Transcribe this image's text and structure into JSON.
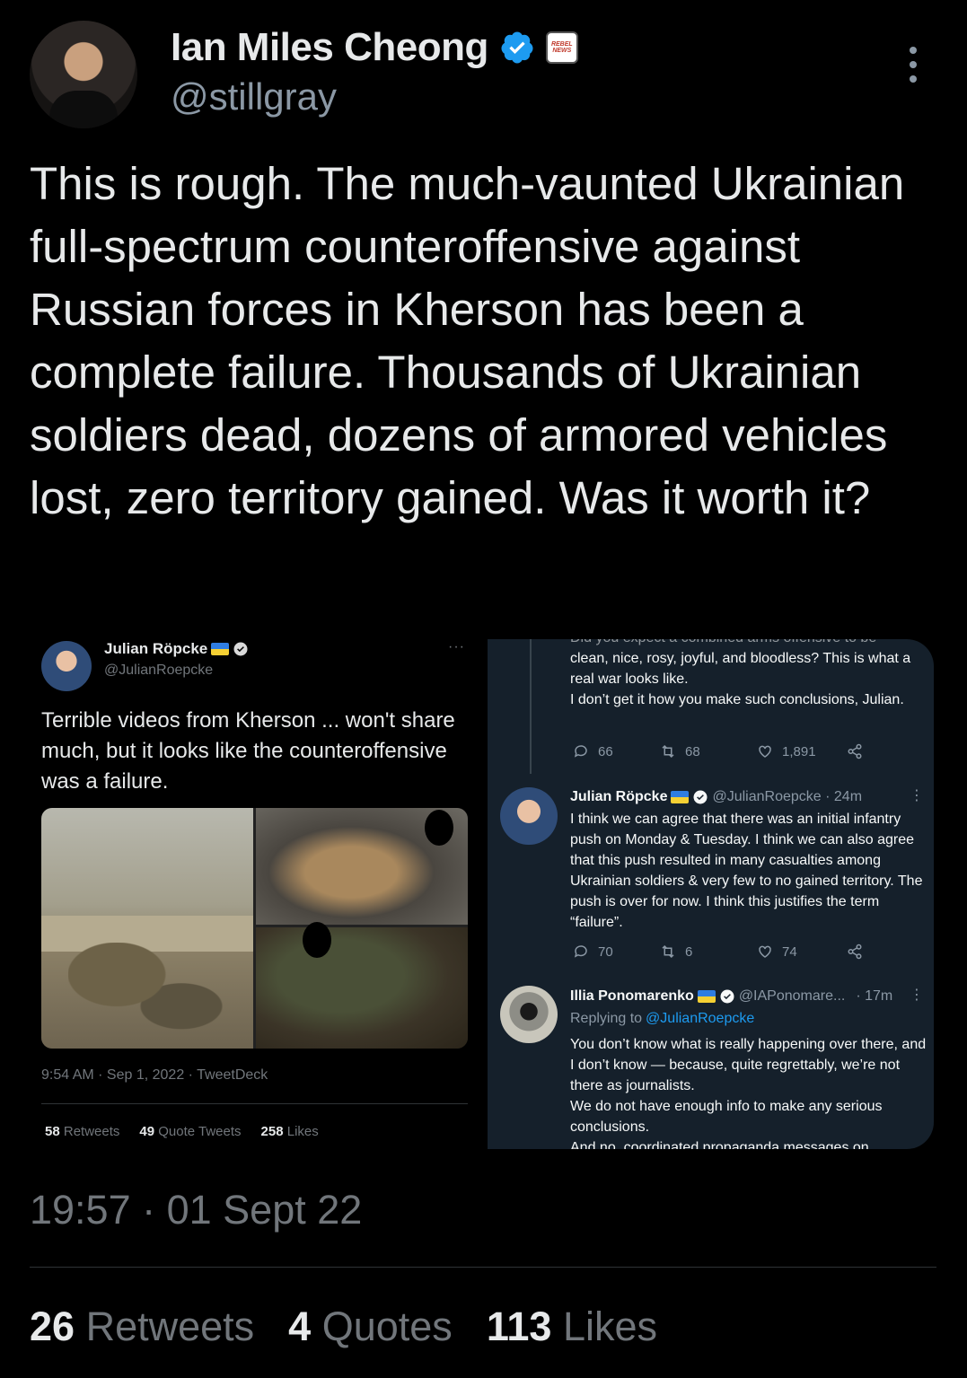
{
  "author": {
    "name": "Ian Miles Cheong",
    "handle": "@stillgray",
    "affiliation_badge": "REBEL NEWS"
  },
  "tweet": {
    "text": "This is rough. The much-vaunted Ukrainian full-spectrum counteroffensive against Russian forces in Kherson has been a complete failure. Thousands of Ukrainian soldiers dead, dozens of armored vehicles lost, zero territory gained. Was it worth it?",
    "timestamp": "19:57 · 01 Sept 22",
    "retweets_count": "26",
    "retweets_label": "Retweets",
    "quotes_count": "4",
    "quotes_label": "Quotes",
    "likes_count": "113",
    "likes_label": "Likes"
  },
  "embedded_left": {
    "name": "Julian Röpcke",
    "handle": "@JulianRoepcke",
    "more": "···",
    "text": "Terrible videos from Kherson ... won't share much, but it looks like the counteroffensive was a failure.",
    "meta": "9:54 AM · Sep 1, 2022 · TweetDeck",
    "retweets_count": "58",
    "retweets_label": "Retweets",
    "quotes_count": "49",
    "quotes_label": "Quote Tweets",
    "likes_count": "258",
    "likes_label": "Likes"
  },
  "embedded_right": {
    "reply1": {
      "text_cut": "Did you expect a combined arms offensive to be",
      "text": "clean, nice, rosy, joyful, and bloodless? This is what a real war looks like.\nI don’t get it how you make such conclusions, Julian.",
      "replies": "66",
      "retweets": "68",
      "likes": "1,891"
    },
    "reply2": {
      "name": "Julian Röpcke",
      "handle_time": "@JulianRoepcke · 24m",
      "text": "I think we can agree that there was an initial infantry push on Monday & Tuesday. I think we can also agree that this push resulted in many casualties among Ukrainian soldiers & very few to no gained territory. The push is over for now. I think this justifies the term “failure”.",
      "replies": "70",
      "retweets": "6",
      "likes": "74"
    },
    "reply3": {
      "name": "Illia Ponomarenko",
      "handle": "@IAPonomare...",
      "time": "· 17m",
      "replying_label": "Replying to",
      "replying_handle": "@JulianRoepcke",
      "text": "You don’t know what is really happening over there, and I don’t know — because, quite regrettably, we’re not there as journalists.\nWe do not have enough info to make any serious conclusions.",
      "text_cut": "And no, coordinated propaganda messages on"
    }
  },
  "colors": {
    "background": "#000000",
    "verified_blue": "#1d9bf0",
    "muted": "#71767b",
    "dim_card": "#15202b"
  }
}
